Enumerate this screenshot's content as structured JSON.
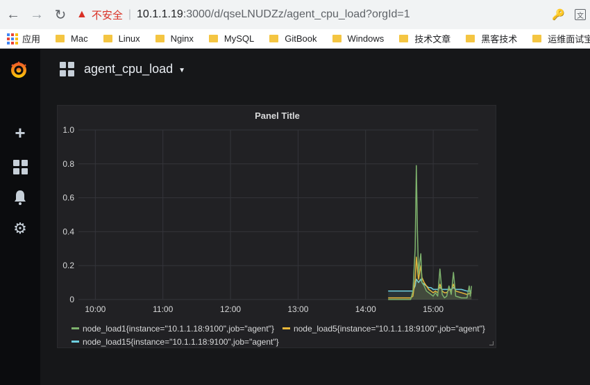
{
  "browser": {
    "insecure_label": "不安全",
    "url_host": "10.1.1.19",
    "url_path": ":3000/d/qseLNUDZz/agent_cpu_load?orgId=1"
  },
  "bookmarks": {
    "apps_label": "应用",
    "items": [
      "Mac",
      "Linux",
      "Nginx",
      "MySQL",
      "GitBook",
      "Windows",
      "技术文章",
      "黑客技术",
      "运维面试宝典"
    ]
  },
  "dashboard": {
    "title": "agent_cpu_load"
  },
  "panel": {
    "title": "Panel Title"
  },
  "colors": {
    "load1": "#7eb26d",
    "load5": "#eab839",
    "load15": "#6ed0e0"
  },
  "chart_data": {
    "type": "line",
    "title": "Panel Title",
    "ylim": [
      0,
      1.0
    ],
    "yticks": [
      "0",
      "0.2",
      "0.4",
      "0.6",
      "0.8",
      "1.0"
    ],
    "xticks": [
      "10:00",
      "11:00",
      "12:00",
      "13:00",
      "14:00",
      "15:00"
    ],
    "grid": true,
    "legend_position": "bottom",
    "series": [
      {
        "name": "node_load1{instance=\"10.1.1.18:9100\",job=\"agent\"}",
        "color": "#7eb26d",
        "x": [
          "14:20",
          "14:40",
          "14:42",
          "14:44",
          "14:45",
          "14:46",
          "14:47",
          "14:48",
          "14:49",
          "14:50",
          "14:52",
          "14:54",
          "14:56",
          "14:58",
          "15:00",
          "15:02",
          "15:04",
          "15:06",
          "15:08",
          "15:10",
          "15:12",
          "15:14",
          "15:16",
          "15:18",
          "15:20",
          "15:25",
          "15:30",
          "15:32",
          "15:33",
          "15:34"
        ],
        "values": [
          0.0,
          0.0,
          0.05,
          0.3,
          0.79,
          0.4,
          0.15,
          0.22,
          0.27,
          0.1,
          0.08,
          0.05,
          0.04,
          0.03,
          0.02,
          0.04,
          0.02,
          0.18,
          0.03,
          0.01,
          0.02,
          0.08,
          0.03,
          0.16,
          0.02,
          0.01,
          0.01,
          0.08,
          0.02,
          0.08
        ]
      },
      {
        "name": "node_load5{instance=\"10.1.1.18:9100\",job=\"agent\"}",
        "color": "#eab839",
        "x": [
          "14:20",
          "14:40",
          "14:42",
          "14:44",
          "14:45",
          "14:46",
          "14:47",
          "14:48",
          "14:49",
          "14:50",
          "14:52",
          "14:54",
          "14:56",
          "14:58",
          "15:00",
          "15:02",
          "15:04",
          "15:06",
          "15:08",
          "15:10",
          "15:12",
          "15:14",
          "15:16",
          "15:18",
          "15:20",
          "15:25",
          "15:30",
          "15:34"
        ],
        "values": [
          0.01,
          0.01,
          0.02,
          0.12,
          0.25,
          0.18,
          0.12,
          0.16,
          0.2,
          0.13,
          0.1,
          0.08,
          0.06,
          0.05,
          0.04,
          0.05,
          0.04,
          0.09,
          0.05,
          0.04,
          0.04,
          0.06,
          0.05,
          0.09,
          0.05,
          0.04,
          0.03,
          0.04
        ]
      },
      {
        "name": "node_load15{instance=\"10.1.1.18:9100\",job=\"agent\"}",
        "color": "#6ed0e0",
        "x": [
          "14:20",
          "14:40",
          "14:42",
          "14:44",
          "14:45",
          "14:46",
          "14:47",
          "14:48",
          "14:49",
          "14:50",
          "14:52",
          "14:54",
          "14:56",
          "14:58",
          "15:00",
          "15:02",
          "15:04",
          "15:06",
          "15:08",
          "15:10",
          "15:12",
          "15:14",
          "15:16",
          "15:18",
          "15:20",
          "15:25",
          "15:30",
          "15:34"
        ],
        "values": [
          0.05,
          0.05,
          0.05,
          0.08,
          0.12,
          0.11,
          0.1,
          0.11,
          0.12,
          0.1,
          0.09,
          0.08,
          0.07,
          0.07,
          0.06,
          0.06,
          0.06,
          0.07,
          0.06,
          0.06,
          0.06,
          0.06,
          0.06,
          0.07,
          0.06,
          0.06,
          0.05,
          0.05
        ]
      }
    ]
  }
}
